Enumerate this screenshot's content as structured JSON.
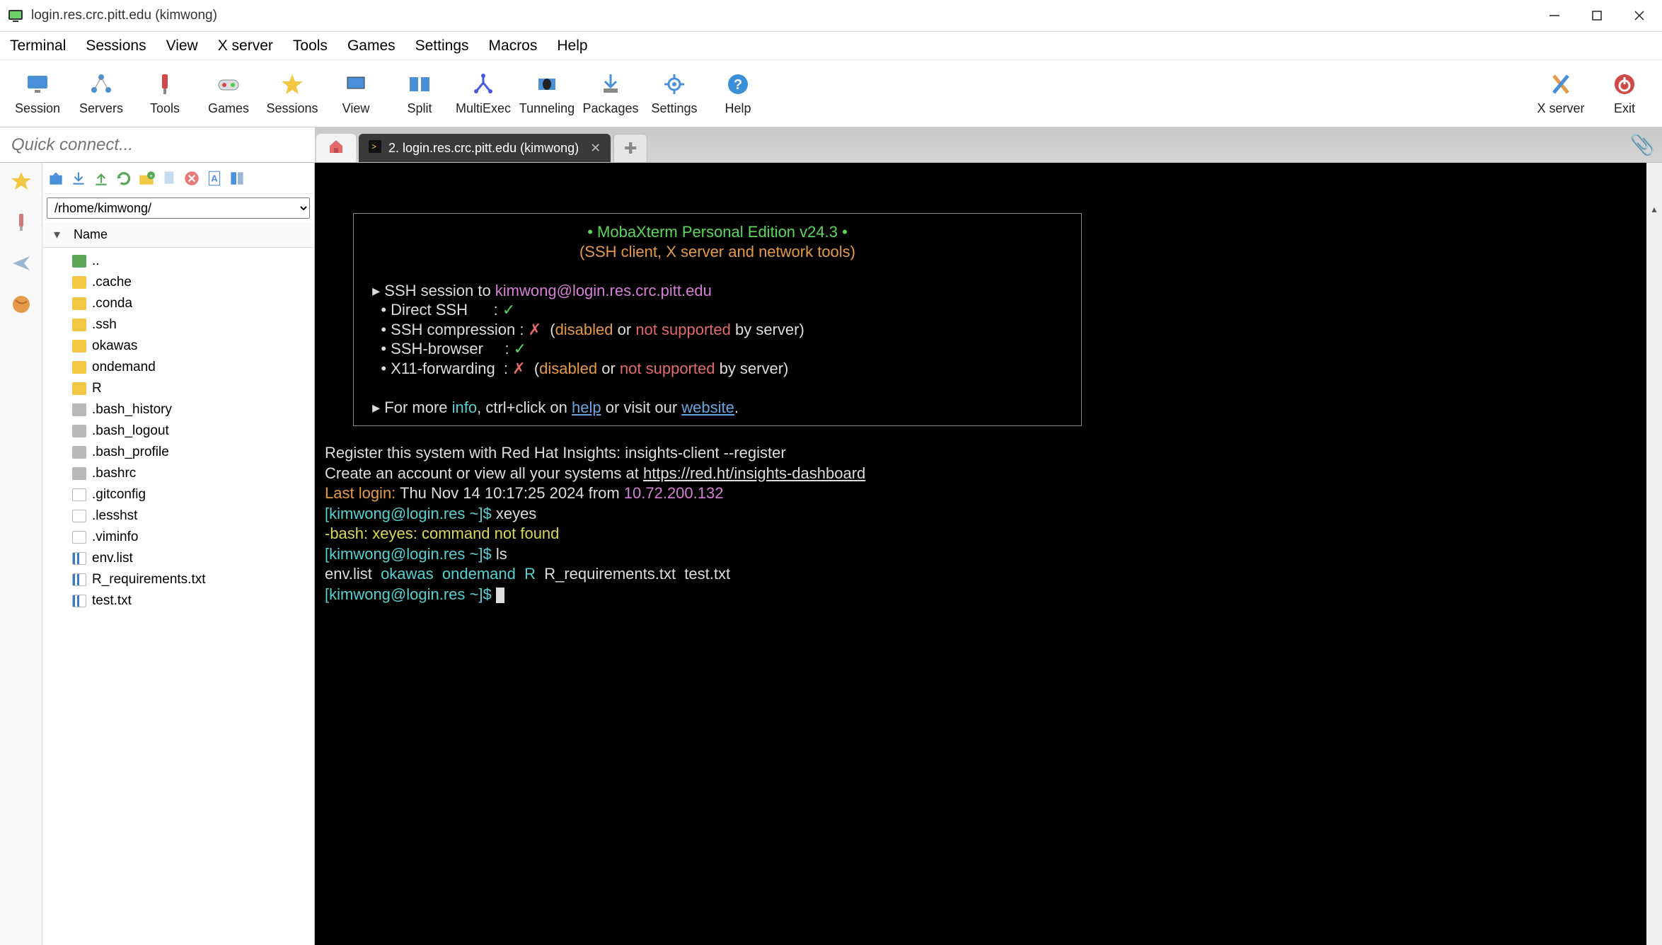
{
  "window": {
    "title": "login.res.crc.pitt.edu (kimwong)"
  },
  "menu": [
    "Terminal",
    "Sessions",
    "View",
    "X server",
    "Tools",
    "Games",
    "Settings",
    "Macros",
    "Help"
  ],
  "toolbar": {
    "session": "Session",
    "servers": "Servers",
    "tools": "Tools",
    "games": "Games",
    "sessions": "Sessions",
    "view": "View",
    "split": "Split",
    "multiexec": "MultiExec",
    "tunneling": "Tunneling",
    "packages": "Packages",
    "settings": "Settings",
    "help": "Help",
    "xserver": "X server",
    "exit": "Exit"
  },
  "quickconnect_placeholder": "Quick connect...",
  "tabs": {
    "active_label": "2. login.res.crc.pitt.edu (kimwong)"
  },
  "sftp": {
    "path": "/rhome/kimwong/",
    "header": "Name",
    "rows": [
      {
        "name": "..",
        "icon": "folder-g"
      },
      {
        "name": ".cache",
        "icon": "folder-y"
      },
      {
        "name": ".conda",
        "icon": "folder-y"
      },
      {
        "name": ".ssh",
        "icon": "folder-y"
      },
      {
        "name": "okawas",
        "icon": "folder-y"
      },
      {
        "name": "ondemand",
        "icon": "folder-y"
      },
      {
        "name": "R",
        "icon": "folder-y"
      },
      {
        "name": ".bash_history",
        "icon": "file-gr"
      },
      {
        "name": ".bash_logout",
        "icon": "file-gr"
      },
      {
        "name": ".bash_profile",
        "icon": "file-gr"
      },
      {
        "name": ".bashrc",
        "icon": "file-gr"
      },
      {
        "name": ".gitconfig",
        "icon": "file-w"
      },
      {
        "name": ".lesshst",
        "icon": "file-w"
      },
      {
        "name": ".viminfo",
        "icon": "file-w"
      },
      {
        "name": "env.list",
        "icon": "file-b"
      },
      {
        "name": "R_requirements.txt",
        "icon": "file-b"
      },
      {
        "name": "test.txt",
        "icon": "file-b"
      }
    ]
  },
  "term": {
    "banner_title": "MobaXterm Personal Edition v24.3",
    "banner_sub": "(SSH client, X server and network tools)",
    "ssh_to_prefix": "SSH session to ",
    "ssh_to_target": "kimwong@login.res.crc.pitt.edu",
    "direct_ssh_label": "Direct SSH      : ",
    "ssh_comp_label": "SSH compression : ",
    "ssh_browser_label": "SSH-browser     : ",
    "x11_label": "X11-forwarding  : ",
    "check": "✓",
    "cross": "✗",
    "disabled_intro": "  (",
    "disabled": "disabled",
    "or": " or ",
    "not_supported": "not supported",
    "by_server": " by server)",
    "moreinfo_prefix": "For more ",
    "info": "info",
    "moreinfo_mid": ", ctrl+click on ",
    "help": "help",
    "moreinfo_mid2": " or visit our ",
    "website": "website",
    "moreinfo_end": ".",
    "register1": "Register this system with Red Hat Insights: insights-client --register",
    "register2_pre": "Create an account or view all your systems at ",
    "register2_link": "https://red.ht/insights-dashboard",
    "lastlogin_label": "Last login:",
    "lastlogin_time": " Thu Nov 14 10:17:25 2024 from ",
    "lastlogin_ip": "10.72.200.132",
    "prompt": "[kimwong@login.res ~]$ ",
    "cmd1": "xeyes",
    "err1": "-bash: xeyes: command not found",
    "cmd2": "ls",
    "ls_envlist": "env.list  ",
    "ls_okawas": "okawas",
    "ls_sep1": "  ",
    "ls_ondemand": "ondemand",
    "ls_sep2": "  ",
    "ls_R": "R",
    "ls_rest": "  R_requirements.txt  test.txt"
  }
}
